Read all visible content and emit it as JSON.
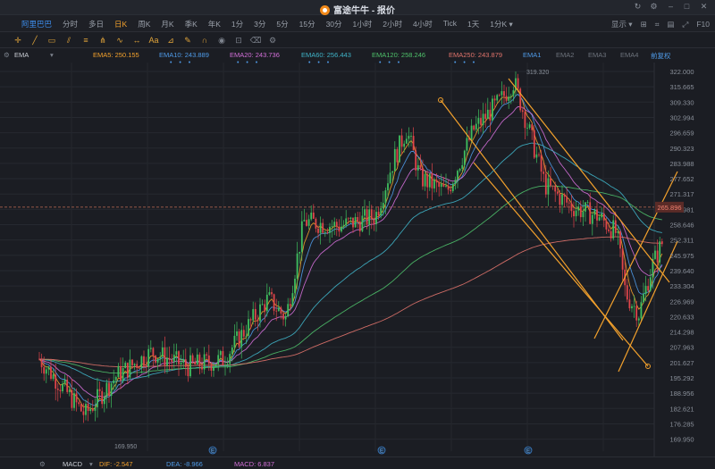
{
  "window": {
    "title": "富途牛牛 - 报价"
  },
  "periods": [
    {
      "label": "阿里巴巴",
      "state": "first"
    },
    {
      "label": "分时"
    },
    {
      "label": "多日"
    },
    {
      "label": "日K",
      "state": "active"
    },
    {
      "label": "周K"
    },
    {
      "label": "月K"
    },
    {
      "label": "季K"
    },
    {
      "label": "年K"
    },
    {
      "label": "1分"
    },
    {
      "label": "3分"
    },
    {
      "label": "5分"
    },
    {
      "label": "15分"
    },
    {
      "label": "30分"
    },
    {
      "label": "1小时"
    },
    {
      "label": "2小时"
    },
    {
      "label": "4小时"
    },
    {
      "label": "Tick"
    },
    {
      "label": "1天"
    },
    {
      "label": "1分K ▾"
    }
  ],
  "period_right": {
    "display": "显示 ▾",
    "f10": "F10"
  },
  "indicator": {
    "name": "EMA",
    "items": [
      {
        "text": "EMA5: 250.155",
        "color": "#f3a12c"
      },
      {
        "text": "EMA10: 243.889",
        "color": "#4f9be8"
      },
      {
        "text": "EMA20: 243.736",
        "color": "#d36fd8"
      },
      {
        "text": "EMA60: 256.443",
        "color": "#3fb3c7"
      },
      {
        "text": "EMA120: 258.246",
        "color": "#4ec06a"
      },
      {
        "text": "EMA250: 243.879",
        "color": "#e0736b"
      },
      {
        "text": "EMA1",
        "color": "#4f9be8"
      },
      {
        "text": "EMA2",
        "color": "#6d737c"
      },
      {
        "text": "EMA3",
        "color": "#6d737c"
      },
      {
        "text": "EMA4",
        "color": "#6d737c"
      }
    ],
    "reset": "前复权"
  },
  "price_axis": [
    "322.000",
    "315.665",
    "309.330",
    "302.994",
    "296.659",
    "290.323",
    "283.988",
    "277.652",
    "271.317",
    "264.981",
    "258.646",
    "252.311",
    "245.975",
    "239.640",
    "233.304",
    "226.969",
    "220.633",
    "214.298",
    "207.963",
    "201.627",
    "195.292",
    "188.956",
    "182.621",
    "176.285",
    "169.950"
  ],
  "current_price_label": "265.896",
  "high_label": "319.320",
  "low_label": "169.950",
  "event_markers": [
    "E",
    "E",
    "E"
  ],
  "macd": {
    "name": "MACD",
    "dif": "DIF: -2.547",
    "dea": "DEA: -8.966",
    "macd": "MACD: 6.837"
  },
  "colors": {
    "up": "#3fbf5f",
    "down": "#e0454a",
    "channel": "#f3a12c",
    "bg": "#1b1d23"
  }
}
